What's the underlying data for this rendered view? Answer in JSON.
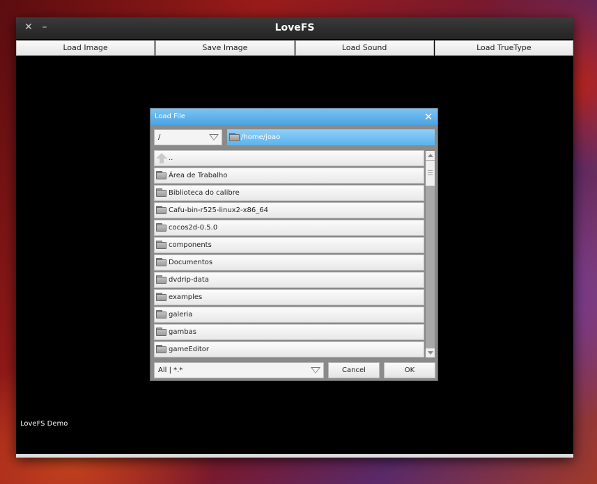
{
  "window": {
    "title": "LoveFS",
    "close_glyph": "✕",
    "minimize_glyph": "–",
    "demo_label": "LoveFS Demo"
  },
  "toolbar": {
    "buttons": [
      "Load Image",
      "Save Image",
      "Load Sound",
      "Load TrueType"
    ]
  },
  "dialog": {
    "title": "Load File",
    "close_glyph": "✕",
    "drive": "/",
    "path": "/home/joao",
    "up_label": "..",
    "folders": [
      "Área de Trabalho",
      "Biblioteca do calibre",
      "Cafu-bin-r525-linux2-x86_64",
      "cocos2d-0.5.0",
      "components",
      "Documentos",
      "dvdrip-data",
      "examples",
      "galeria",
      "gambas",
      "gameEditor"
    ],
    "filter": "All | *.*",
    "cancel_label": "Cancel",
    "ok_label": "OK"
  },
  "colors": {
    "dialog_title_bg": "#5aaee8",
    "path_bar_bg": "#6dbdf0",
    "window_bg": "#000000"
  },
  "icons": [
    "close-icon",
    "minimize-icon",
    "folder-icon",
    "up-arrow-icon",
    "dropdown-arrow-icon"
  ]
}
